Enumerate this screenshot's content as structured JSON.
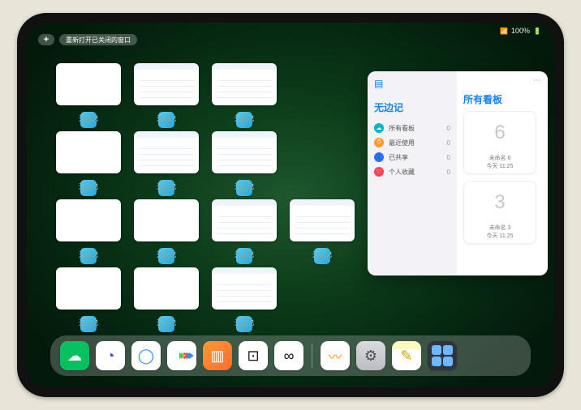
{
  "status": {
    "battery": "100%",
    "wifi": "wifi"
  },
  "top_controls": {
    "plus": "+",
    "reopen_label": "重新打开已关闭的窗口"
  },
  "app_thumb_label": "无边记",
  "thumbs": [
    {
      "style": "plain"
    },
    {
      "style": "detailed"
    },
    {
      "style": "detailed"
    },
    {
      "style": "plain"
    },
    {
      "style": "detailed"
    },
    {
      "style": "detailed"
    },
    {
      "style": "plain"
    },
    {
      "style": "plain"
    },
    {
      "style": "detailed"
    },
    {
      "style": "detailed"
    },
    {
      "style": "plain"
    },
    {
      "style": "plain"
    },
    {
      "style": "detailed"
    }
  ],
  "panel": {
    "title": "无边记",
    "right_title": "所有看板",
    "ellipsis": "⋯",
    "categories": [
      {
        "icon": "teal",
        "glyph": "☁",
        "label": "所有看板",
        "count": "0"
      },
      {
        "icon": "orange",
        "glyph": "⏱",
        "label": "最近使用",
        "count": "0"
      },
      {
        "icon": "blue",
        "glyph": "👤",
        "label": "已共享",
        "count": "0"
      },
      {
        "icon": "red",
        "glyph": "♡",
        "label": "个人收藏",
        "count": "0"
      }
    ],
    "boards": [
      {
        "glyph": "6",
        "name": "未命名 6",
        "time": "今天 11:25"
      },
      {
        "glyph": "3",
        "name": "未命名 3",
        "time": "今天 11:25"
      }
    ]
  },
  "dock": {
    "apps": [
      {
        "name": "wechat",
        "glyph": "☁"
      },
      {
        "name": "huya",
        "glyph": "◔"
      },
      {
        "name": "qbrowse",
        "glyph": "◯"
      },
      {
        "name": "iqiyi",
        "glyph": ""
      },
      {
        "name": "books",
        "glyph": "▥"
      },
      {
        "name": "reader",
        "glyph": "⊡"
      },
      {
        "name": "migu",
        "glyph": "∞"
      },
      {
        "name": "freeform",
        "glyph": ""
      },
      {
        "name": "settings",
        "glyph": "⚙"
      },
      {
        "name": "notes",
        "glyph": "✎"
      },
      {
        "name": "folder",
        "glyph": ""
      }
    ]
  }
}
